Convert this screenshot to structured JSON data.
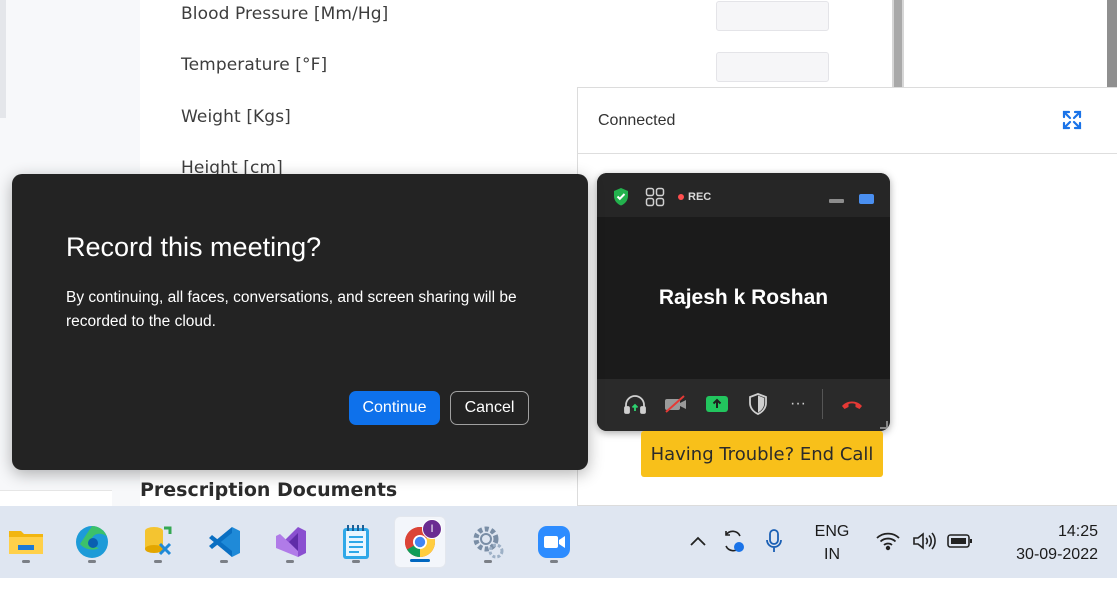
{
  "form": {
    "fields": [
      {
        "label": "Blood Pressure [Mm/Hg]"
      },
      {
        "label": "Temperature [°F]"
      },
      {
        "label": "Weight [Kgs]"
      },
      {
        "label": "Height [cm]"
      }
    ],
    "section_title": "Prescription Documents"
  },
  "connected_panel": {
    "status": "Connected",
    "expand_icon": "expand-arrows-icon"
  },
  "zoom_window": {
    "rec_label": "REC",
    "participant_name": "Rajesh k Roshan",
    "controls": [
      "headphones-icon",
      "video-off-icon",
      "share-screen-icon",
      "security-shield-icon",
      "more-icon",
      "end-call-icon"
    ]
  },
  "trouble_button": "Having Trouble? End Call",
  "record_dialog": {
    "title": "Record this meeting?",
    "body": "By continuing, all faces, conversations, and screen sharing will be recorded to the cloud.",
    "continue_label": "Continue",
    "cancel_label": "Cancel"
  },
  "taskbar": {
    "apps": [
      "file-explorer",
      "edge",
      "database-tool",
      "vscode",
      "visual-studio",
      "notepad",
      "chrome",
      "settings",
      "zoom"
    ],
    "chrome_badge": "I",
    "tray": {
      "language_line1": "ENG",
      "language_line2": "IN",
      "time": "14:25",
      "date": "30-09-2022"
    }
  },
  "colors": {
    "accent_blue": "#0e71eb",
    "trouble_yellow": "#f8c01a",
    "dialog_bg": "#232323",
    "end_call_red": "#e53935",
    "share_green": "#22c55e"
  }
}
